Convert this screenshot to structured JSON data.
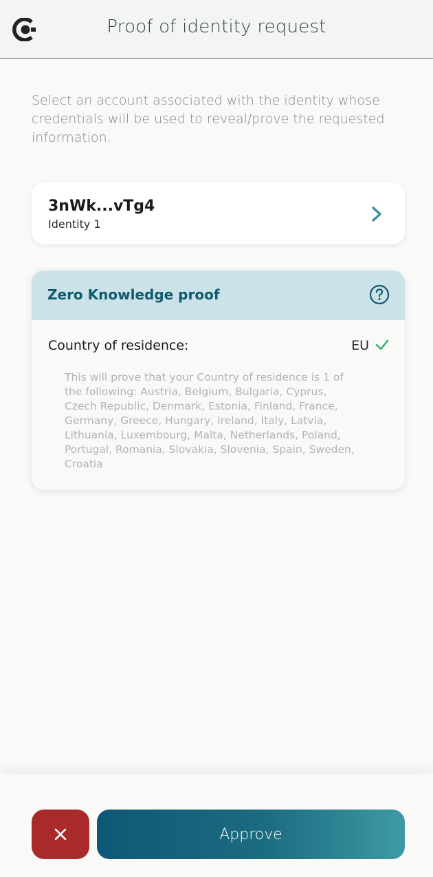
{
  "header": {
    "title": "Proof of identity request",
    "logo_icon": "app-logo-icon"
  },
  "intro_text": "Select an account associated with the identity whose credentials will be used to reveal/prove the requested information.",
  "account": {
    "address": "3nWk...vTg4",
    "identity_name": "Identity 1",
    "chevron_icon": "chevron-right-icon"
  },
  "zk_proof": {
    "title": "Zero Knowledge proof",
    "help_icon": "question-circle-icon",
    "attribute": {
      "label": "Country of residence:",
      "value": "EU",
      "status_icon": "check-icon",
      "status_color": "#3bb36f",
      "description": "This will prove that your Country of residence is 1 of the following: Austria, Belgium, Bulgaria, Cyprus, Czech Republic, Denmark, Estonia, Finland, France, Germany, Greece, Hungary, Ireland, Italy, Latvia, Lithuania, Luxembourg, Malta, Netherlands, Poland, Portugal, Romania, Slovakia, Slovenia, Spain, Sweden, Croatia"
    }
  },
  "footer": {
    "reject_icon": "close-icon",
    "approve_label": "Approve"
  },
  "colors": {
    "accent": "#0f5a6e",
    "reject": "#a82a2a",
    "zk_header_bg": "#cbe3e8",
    "chevron": "#3d8f9e"
  }
}
